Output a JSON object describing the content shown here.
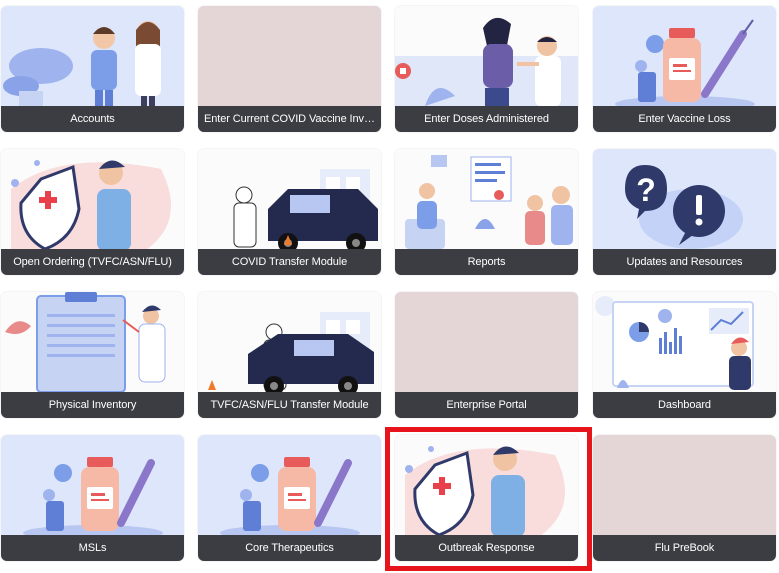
{
  "tiles": [
    {
      "label": "Accounts",
      "icon": "doctors-illustration-icon"
    },
    {
      "label": "Enter Current COVID Vaccine Inven...",
      "icon": "blank-placeholder-icon"
    },
    {
      "label": "Enter Doses Administered",
      "icon": "vaccination-illustration-icon"
    },
    {
      "label": "Enter Vaccine Loss",
      "icon": "vaccine-vial-illustration-icon"
    },
    {
      "label": "Open Ordering (TVFC/ASN/FLU)",
      "icon": "doctor-shield-illustration-icon"
    },
    {
      "label": "COVID Transfer Module",
      "icon": "drive-through-illustration-icon"
    },
    {
      "label": "Reports",
      "icon": "clinic-illustration-icon"
    },
    {
      "label": "Updates and Resources",
      "icon": "question-exclamation-illustration-icon"
    },
    {
      "label": "Physical Inventory",
      "icon": "clipboard-illustration-icon"
    },
    {
      "label": "TVFC/ASN/FLU Transfer Module",
      "icon": "drive-through-illustration-icon"
    },
    {
      "label": "Enterprise Portal",
      "icon": "blank-placeholder-icon"
    },
    {
      "label": "Dashboard",
      "icon": "dashboard-illustration-icon"
    },
    {
      "label": "MSLs",
      "icon": "vaccine-vial-illustration-icon"
    },
    {
      "label": "Core Therapeutics",
      "icon": "vaccine-vial-illustration-icon"
    },
    {
      "label": "Outbreak Response",
      "icon": "doctor-shield-illustration-icon"
    },
    {
      "label": "Flu PreBook",
      "icon": "blank-placeholder-icon"
    }
  ],
  "colors": {
    "label_bar": "#3b3d42",
    "tile_blue": "#dde6fb",
    "tile_pink": "#e4d6d6",
    "highlight": "#e8141b"
  }
}
